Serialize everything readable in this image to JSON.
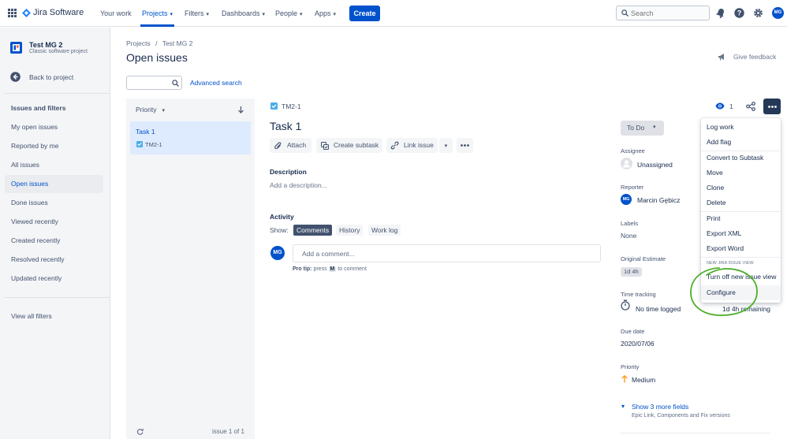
{
  "topnav": {
    "product_name": "Jira Software",
    "items": [
      {
        "label": "Your work",
        "dropdown": false
      },
      {
        "label": "Projects",
        "dropdown": true
      },
      {
        "label": "Filters",
        "dropdown": true
      },
      {
        "label": "Dashboards",
        "dropdown": true
      },
      {
        "label": "People",
        "dropdown": true
      },
      {
        "label": "Apps",
        "dropdown": true
      }
    ],
    "create_label": "Create",
    "search_placeholder": "Search",
    "user_initials": "MG"
  },
  "sidebar": {
    "project_name": "Test MG 2",
    "project_type": "Classic software project",
    "back_label": "Back to project",
    "section_title": "Issues and filters",
    "items": [
      {
        "label": "My open issues"
      },
      {
        "label": "Reported by me"
      },
      {
        "label": "All issues"
      },
      {
        "label": "Open issues"
      },
      {
        "label": "Done issues"
      },
      {
        "label": "Viewed recently"
      },
      {
        "label": "Created recently"
      },
      {
        "label": "Resolved recently"
      },
      {
        "label": "Updated recently"
      }
    ],
    "view_all_label": "View all filters"
  },
  "page": {
    "breadcrumb_projects": "Projects",
    "breadcrumb_sep": "/",
    "breadcrumb_project": "Test MG 2",
    "title": "Open issues",
    "advanced_search": "Advanced search",
    "give_feedback": "Give feedback"
  },
  "list": {
    "sort_label": "Priority",
    "issue_title": "Task 1",
    "issue_key": "TM2-1",
    "footer": "issue 1 of 1"
  },
  "issue": {
    "key": "TM2-1",
    "title": "Task 1",
    "watch_count": "1",
    "actions": {
      "attach": "Attach",
      "create_subtask": "Create subtask",
      "link_issue": "Link issue"
    },
    "description_heading": "Description",
    "description_placeholder": "Add a description...",
    "activity_heading": "Activity",
    "show_label": "Show:",
    "tabs": [
      "Comments",
      "History",
      "Work log"
    ],
    "comment_placeholder": "Add a comment...",
    "pro_tip_bold": "Pro tip:",
    "pro_tip_press": "press",
    "pro_tip_key": "M",
    "pro_tip_rest": "to comment",
    "user_initials": "MG"
  },
  "details": {
    "status": "To Do",
    "assignee_label": "Assignee",
    "assignee_value": "Unassigned",
    "reporter_label": "Reporter",
    "reporter_value": "Marcin Gębicz",
    "reporter_initials": "MG",
    "labels_label": "Labels",
    "labels_value": "None",
    "estimate_label": "Original Estimate",
    "estimate_value": "1d 4h",
    "time_label": "Time tracking",
    "time_logged": "No time logged",
    "time_remaining": "1d 4h remaining",
    "due_label": "Due date",
    "due_value": "2020/07/06",
    "priority_label": "Priority",
    "priority_value": "Medium",
    "more_fields": "Show 3 more fields",
    "more_fields_sub": "Epic Link, Components and Fix versions"
  },
  "menu": {
    "items_a": [
      "Log work",
      "Add flag"
    ],
    "items_b": [
      "Convert to Subtask",
      "Move",
      "Clone",
      "Delete"
    ],
    "items_c": [
      "Print",
      "Export XML",
      "Export Word"
    ],
    "section_title": "NEW JIRA ISSUE VIEW",
    "turn_off": "Turn off new issue view",
    "configure": "Configure"
  },
  "colors": {
    "brand": "#0052cc",
    "highlight_circle": "#4caf2a",
    "priority_medium": "#ff991f"
  }
}
